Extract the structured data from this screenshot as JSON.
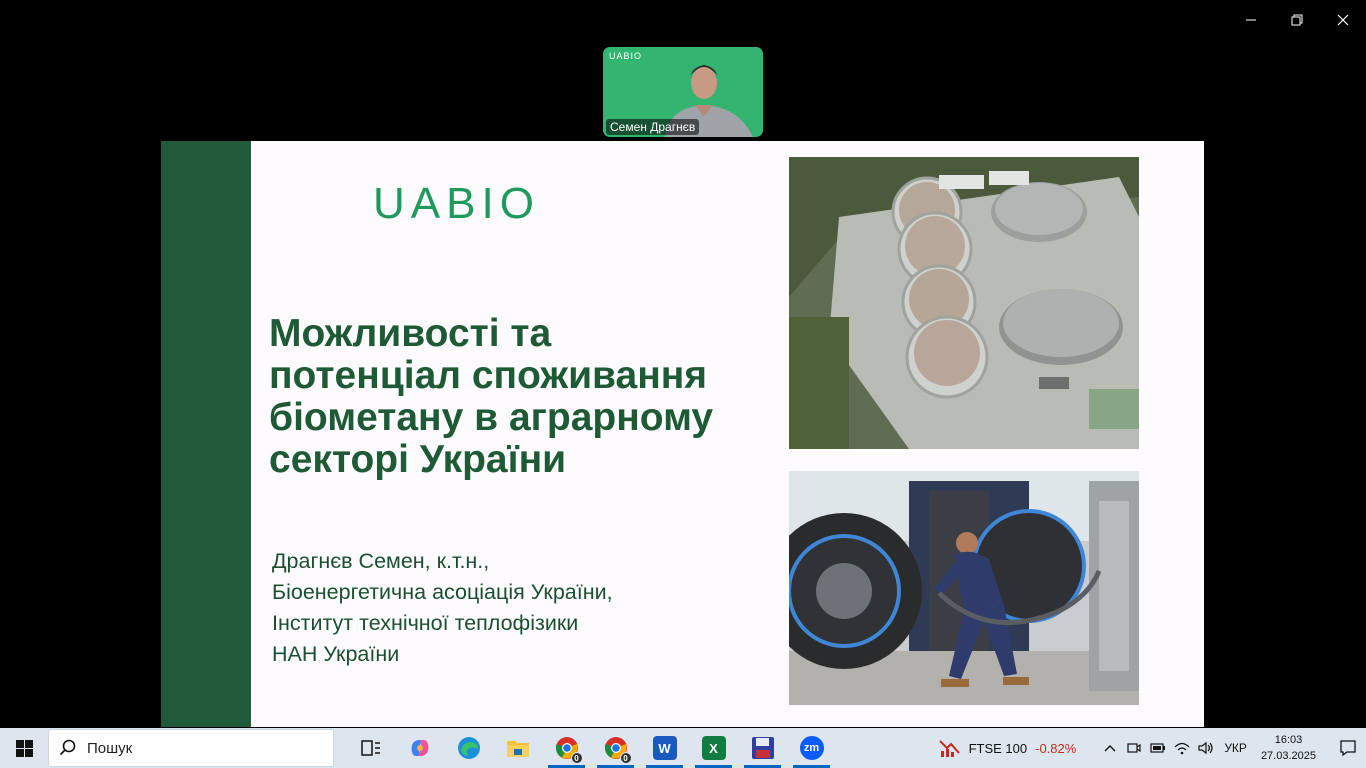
{
  "window": {
    "controls": [
      "minimize",
      "restore",
      "close"
    ]
  },
  "participant": {
    "name": "Семен Драгнєв",
    "logo": "UABIO",
    "background_color": "#33b46f"
  },
  "slide": {
    "brand": "UABIO",
    "title_lines": [
      "Можливості та",
      "потенціал споживання",
      "біометану в аграрному",
      "секторі України"
    ],
    "author_lines": [
      "Драгнєв Семен, к.т.н.,",
      "Біоенергетична асоціація України,",
      "Інститут технічної теплофізики",
      "НАН України"
    ],
    "accent_color": "#215a3a",
    "title_color": "#1f5a36"
  },
  "taskbar": {
    "search_placeholder": "Пошук",
    "apps": [
      {
        "name": "task-view",
        "icon": "task-view-icon"
      },
      {
        "name": "copilot",
        "icon": "copilot-icon"
      },
      {
        "name": "edge",
        "icon": "edge-icon"
      },
      {
        "name": "file-explorer",
        "icon": "folder-icon"
      },
      {
        "name": "chrome-1",
        "icon": "chrome-icon",
        "badge": "0"
      },
      {
        "name": "chrome-2",
        "icon": "chrome-icon",
        "badge": "0"
      },
      {
        "name": "word",
        "icon": "word-icon",
        "label": "W"
      },
      {
        "name": "excel",
        "icon": "excel-icon",
        "label": "X"
      },
      {
        "name": "save",
        "icon": "floppy-icon"
      },
      {
        "name": "zoom",
        "icon": "zoom-icon",
        "label": "zm"
      }
    ],
    "stock": {
      "name": "FTSE 100",
      "change": "-0.82%"
    },
    "language": "УКР",
    "time": "16:03",
    "date": "27.03.2025"
  }
}
